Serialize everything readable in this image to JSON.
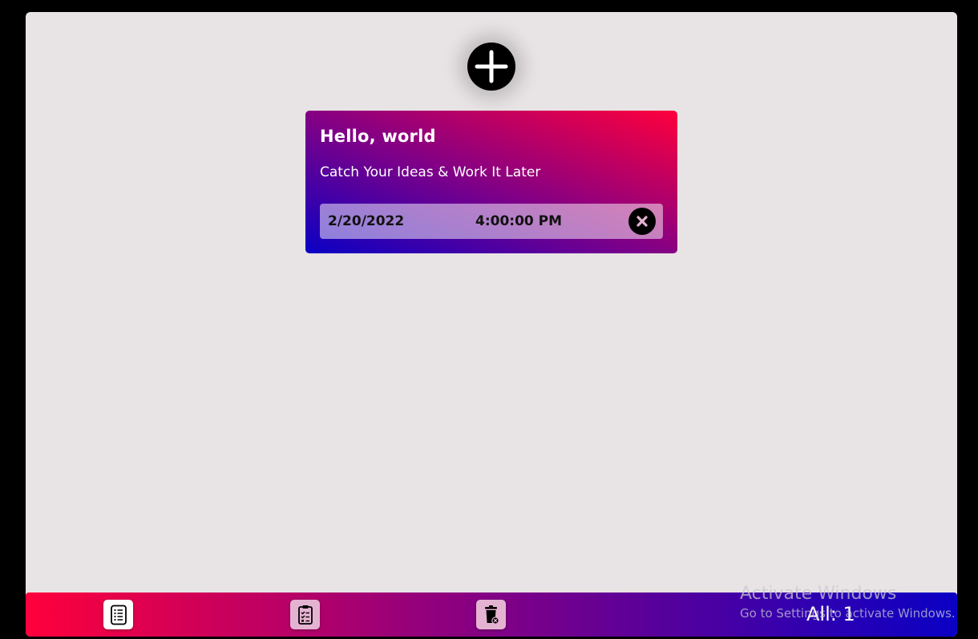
{
  "add_button": {
    "icon": "plus-icon"
  },
  "note": {
    "title": "Hello, world",
    "body": "Catch Your Ideas & Work It Later",
    "date": "2/20/2022",
    "time": "4:00:00 PM",
    "delete_icon": "close-icon"
  },
  "bottom_bar": {
    "buttons": [
      {
        "icon": "list-icon",
        "active": true
      },
      {
        "icon": "clipboard-check-icon",
        "active": false
      },
      {
        "icon": "trash-icon",
        "active": false
      }
    ],
    "count_label": "All: 1"
  },
  "watermark": {
    "title": "Activate Windows",
    "subtitle": "Go to Settings to activate Windows."
  },
  "colors": {
    "page_background": "#000000",
    "app_background": "#e8e4e5",
    "gradient_pink": "#ff003c",
    "gradient_blue": "#0a00c4"
  }
}
